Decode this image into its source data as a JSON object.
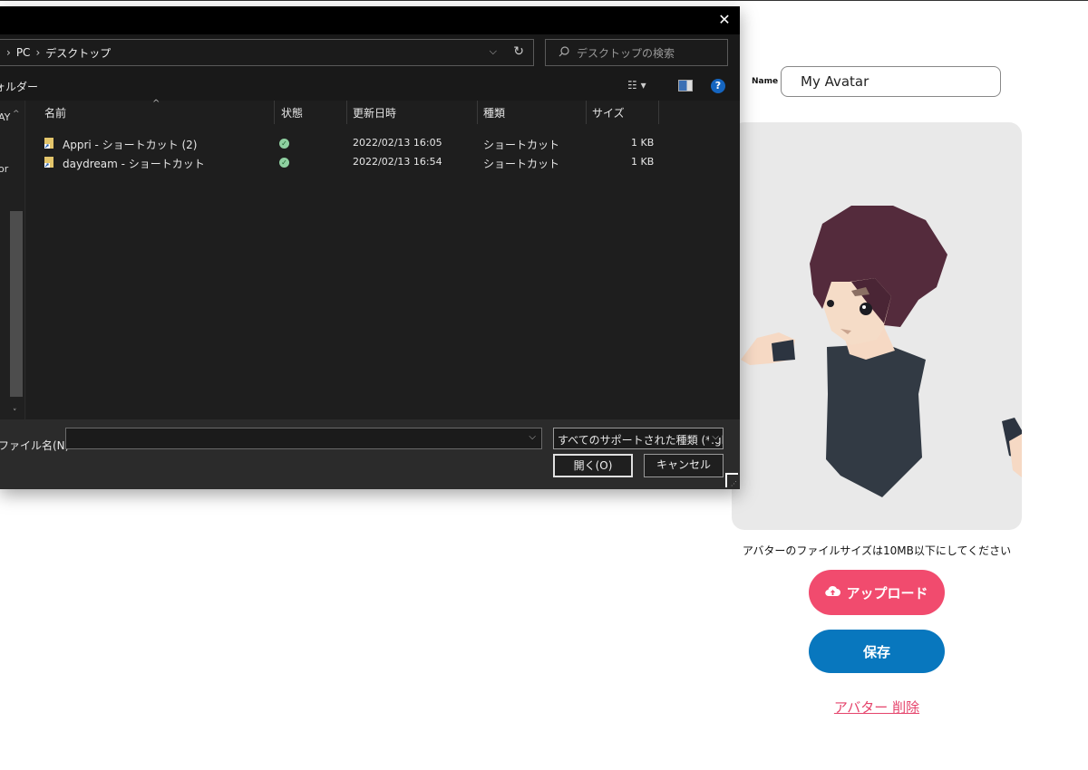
{
  "page": {
    "name_label": "Name",
    "name_value": "My Avatar",
    "size_note": "アバターのファイルサイズは10MB以下にしてください",
    "upload_label": "アップロード",
    "save_label": "保存",
    "delete_label": "アバター 削除"
  },
  "dialog": {
    "close_glyph": "✕",
    "breadcrumb": [
      "PC",
      "デスクトップ"
    ],
    "search_placeholder": "デスクトップの検索",
    "new_folder_label": "ォルダー",
    "nav_texts": [
      "AY",
      "or"
    ],
    "columns": [
      "名前",
      "状態",
      "更新日時",
      "種類",
      "サイズ"
    ],
    "files": [
      {
        "name": "Appri - ショートカット (2)",
        "date": "2022/02/13 16:05",
        "type": "ショートカット",
        "size": "1 KB"
      },
      {
        "name": "daydream - ショートカット",
        "date": "2022/02/13 16:54",
        "type": "ショートカット",
        "size": "1 KB"
      }
    ],
    "filename_label": "ファイル名(N):",
    "filename_value": "",
    "filetype_value": "すべてのサポートされた種類 (*.glb;*",
    "open_label": "開く(O)",
    "cancel_label": "キャンセル"
  },
  "icons": {
    "upload": "cloud-upload-icon",
    "search": "search-icon",
    "refresh": "refresh-icon",
    "help": "help-icon",
    "file": "shortcut-file-icon",
    "status": "synced-check-icon"
  },
  "colors": {
    "upload_button": "#f14b6e",
    "save_button": "#0877be",
    "delete_link": "#e5436b",
    "dialog_background": "#202020"
  }
}
